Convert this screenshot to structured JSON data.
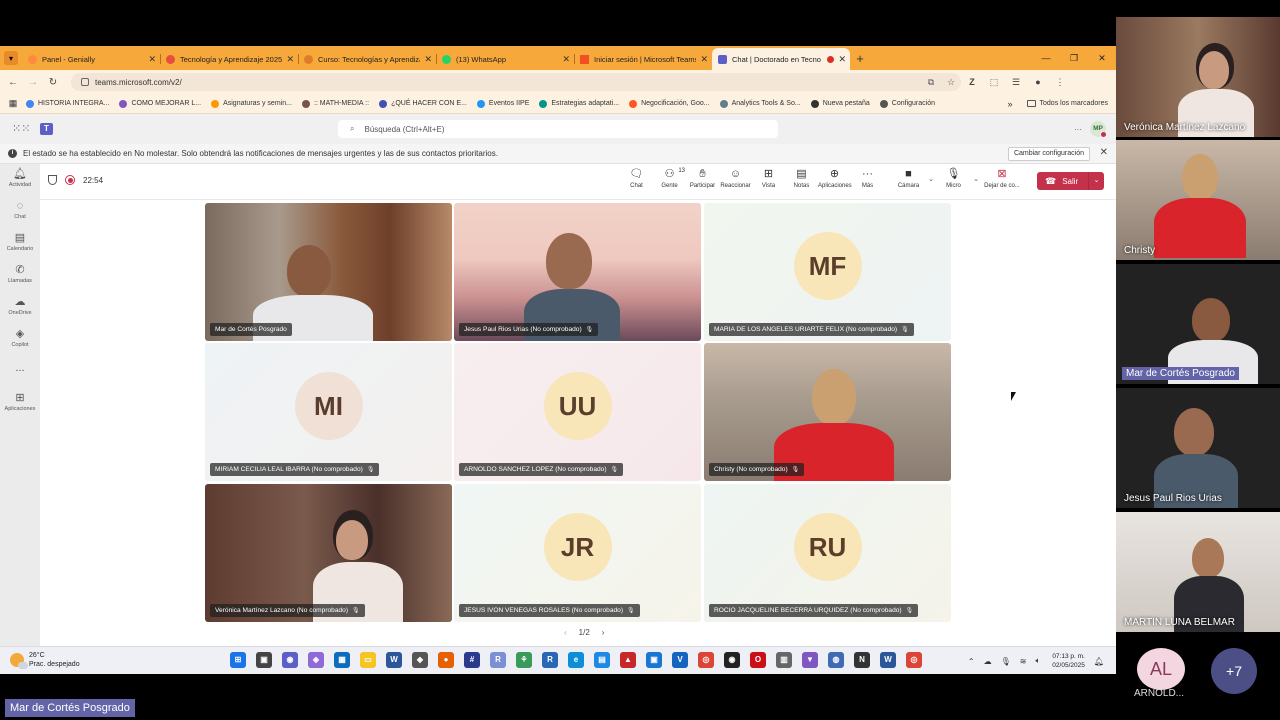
{
  "browser": {
    "tabs": [
      {
        "title": "Panel - Genially",
        "color": "#ff8a3d"
      },
      {
        "title": "Tecnología y Aprendizaje 2025",
        "color": "#e84d3d"
      },
      {
        "title": "Curso: Tecnologías y Aprendiza",
        "color": "#e07b2a"
      },
      {
        "title": "(13) WhatsApp",
        "color": "#25d366"
      },
      {
        "title": "Iniciar sesión | Microsoft Teams",
        "color": "#f25022"
      },
      {
        "title": "Chat | Doctorado en Tecno",
        "color": "#5b5fc7"
      }
    ],
    "url": "teams.microsoft.com/v2/",
    "bookmarks": [
      {
        "label": "HISTORIA INTEGRA...",
        "color": "#4285f4"
      },
      {
        "label": "COMO MEJORAR L...",
        "color": "#7e57c2"
      },
      {
        "label": "Asignaturas y semin...",
        "color": "#ff9800"
      },
      {
        "label": ":: MATH-MEDIA ::",
        "color": "#795548"
      },
      {
        "label": "¿QUÉ HACER CON E...",
        "color": "#3f51b5"
      },
      {
        "label": "Eventos IIPE",
        "color": "#2196f3"
      },
      {
        "label": "Estrategias adaptati...",
        "color": "#009688"
      },
      {
        "label": "Negocificación, Goo...",
        "color": "#ff5722"
      },
      {
        "label": "Analytics Tools & So...",
        "color": "#607d8b"
      },
      {
        "label": "Nueva pestaña",
        "color": "#333333"
      },
      {
        "label": "Configuración",
        "color": "#555555"
      }
    ],
    "all_bookmarks": "Todos los marcadores"
  },
  "teams": {
    "search_placeholder": "Búsqueda (Ctrl+Alt+E)",
    "user_initials": "MP",
    "banner_text": "El estado se ha establecido en No molestar. Solo obtendrá las notificaciones de mensajes urgentes y las de sus contactos prioritarios.",
    "banner_button": "Cambiar configuración",
    "rail": [
      {
        "label": "Actividad",
        "icon": "bell-icon"
      },
      {
        "label": "Chat",
        "icon": "chat-icon"
      },
      {
        "label": "Calendario",
        "icon": "calendar-icon"
      },
      {
        "label": "Llamadas",
        "icon": "phone-icon"
      },
      {
        "label": "OneDrive",
        "icon": "cloud-icon"
      },
      {
        "label": "Copilot",
        "icon": "copilot-icon"
      },
      {
        "label": "...",
        "icon": "more-icon"
      },
      {
        "label": "Aplicaciones",
        "icon": "plus-icon"
      }
    ],
    "meeting": {
      "timer": "22:54",
      "tools": [
        {
          "label": "Chat",
          "icon": "chat-icon"
        },
        {
          "label": "Gente",
          "icon": "people-icon",
          "count": "13"
        },
        {
          "label": "Participar",
          "icon": "hand-icon"
        },
        {
          "label": "Reaccionar",
          "icon": "smile-icon"
        },
        {
          "label": "Vista",
          "icon": "grid-icon"
        },
        {
          "label": "Notas",
          "icon": "notes-icon"
        },
        {
          "label": "Aplicaciones",
          "icon": "plus-icon"
        },
        {
          "label": "Más",
          "icon": "more-icon"
        }
      ],
      "camera_label": "Cámara",
      "mic_label": "Micro",
      "share_label": "Dejar de co...",
      "leave_label": "Salir",
      "pager": "1/2"
    },
    "tiles": [
      {
        "name": "Mar de Cortés Posgrado",
        "type": "video",
        "muted": false
      },
      {
        "name": "Jesus Paul Rios Urias (No comprobado)",
        "type": "video",
        "muted": true
      },
      {
        "name": "MARIA DE LOS ANGELES URIARTE FELIX (No comprobado)",
        "initials": "MF",
        "type": "avatar",
        "muted": true
      },
      {
        "name": "MIRIAM CECILIA LEAL IBARRA (No comprobado)",
        "initials": "MI",
        "type": "avatar",
        "muted": true
      },
      {
        "name": "ARNOLDO SANCHEZ LOPEZ (No comprobado)",
        "initials": "UU",
        "type": "avatar",
        "muted": true
      },
      {
        "name": "Christy (No comprobado)",
        "type": "video",
        "muted": true
      },
      {
        "name": "Verónica Martínez Lazcano (No comprobado)",
        "type": "video",
        "muted": true
      },
      {
        "name": "JESUS IVON VENEGAS ROSALES (No comprobado)",
        "initials": "JR",
        "type": "avatar",
        "muted": true
      },
      {
        "name": "ROCIO JACQUELINE BECERRA URQUIDEZ (No comprobado)",
        "initials": "RU",
        "type": "avatar",
        "muted": true
      }
    ]
  },
  "taskbar": {
    "temperature": "26°C",
    "weather": "Prac. despejado",
    "time": "07:13 p. m.",
    "date": "02/05/2025"
  },
  "side_panel": {
    "participants": [
      {
        "name": "Verónica Martínez Lazcano"
      },
      {
        "name": "Christy"
      },
      {
        "name": "Mar de Cortés Posgrado",
        "speaking": true
      },
      {
        "name": "Jesus Paul Rios Urias"
      },
      {
        "name": "MARTIN   LUNA BELMAR"
      }
    ],
    "extra_initials": "AL",
    "extra_name": "ARNOLD...",
    "more_count": "+7"
  },
  "active_speaker_label": "Mar de Cortés Posgrado"
}
